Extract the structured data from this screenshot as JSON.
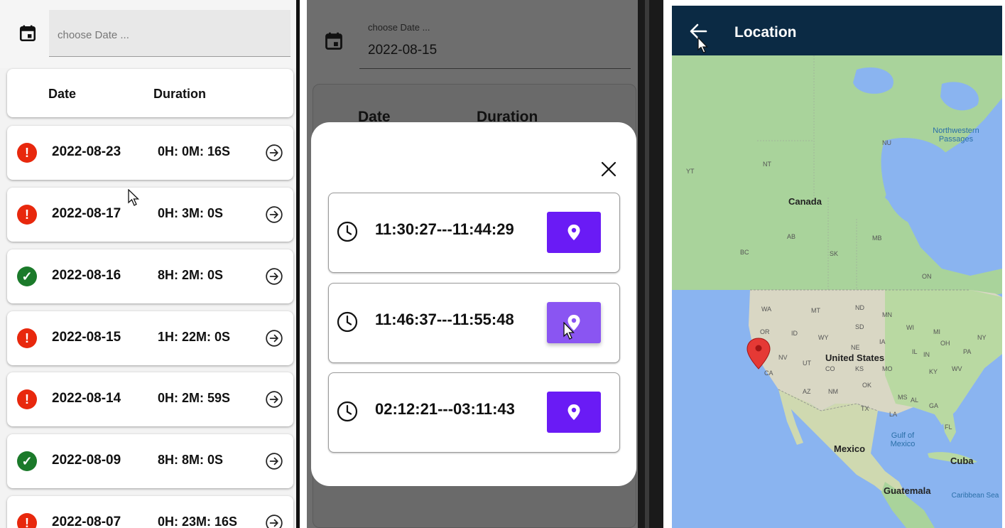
{
  "panel1": {
    "date_placeholder": "choose Date ...",
    "header": {
      "date": "Date",
      "duration": "Duration"
    },
    "rows": [
      {
        "status": "error",
        "date": "2022-08-23",
        "duration": "0H: 0M: 16S"
      },
      {
        "status": "error",
        "date": "2022-08-17",
        "duration": "0H: 3M: 0S"
      },
      {
        "status": "ok",
        "date": "2022-08-16",
        "duration": "8H: 2M: 0S"
      },
      {
        "status": "error",
        "date": "2022-08-15",
        "duration": "1H: 22M: 0S"
      },
      {
        "status": "error",
        "date": "2022-08-14",
        "duration": "0H: 2M: 59S"
      },
      {
        "status": "ok",
        "date": "2022-08-09",
        "duration": "8H: 8M: 0S"
      },
      {
        "status": "error",
        "date": "2022-08-07",
        "duration": "0H: 23M: 16S"
      }
    ],
    "status_symbols": {
      "error": "!",
      "ok": "✓"
    },
    "colors": {
      "error": "#e8280d",
      "ok": "#1b7a2a"
    }
  },
  "panel2": {
    "date_label": "choose Date ...",
    "date_value": "2022-08-15",
    "header": {
      "date": "Date",
      "duration": "Duration"
    },
    "slots": [
      {
        "time": "11:30:27---11:44:29"
      },
      {
        "time": "11:46:37---11:55:48"
      },
      {
        "time": "02:12:21---03:11:43"
      }
    ],
    "accent": "#6a1bf5"
  },
  "panel3": {
    "title": "Location",
    "map_labels": {
      "canada": "Canada",
      "united_states": "United States",
      "mexico": "Mexico",
      "cuba": "Cuba",
      "guatemala": "Guatemala",
      "gulf": "Gulf of Mexico",
      "northwestern": "Northwestern Passages",
      "caribbean": "Caribbean Sea"
    },
    "state_codes": [
      "NU",
      "NT",
      "YT",
      "AB",
      "MB",
      "SK",
      "BC",
      "ON",
      "WA",
      "MT",
      "ND",
      "MN",
      "OR",
      "ID",
      "SD",
      "WY",
      "NE",
      "IA",
      "CA",
      "NV",
      "UT",
      "CO",
      "KS",
      "MO",
      "AZ",
      "NM",
      "OK",
      "TX",
      "LA",
      "MS",
      "AL",
      "GA",
      "FL",
      "WI",
      "MI",
      "IL",
      "IN",
      "OH",
      "KY",
      "WV",
      "PA",
      "NY"
    ]
  }
}
